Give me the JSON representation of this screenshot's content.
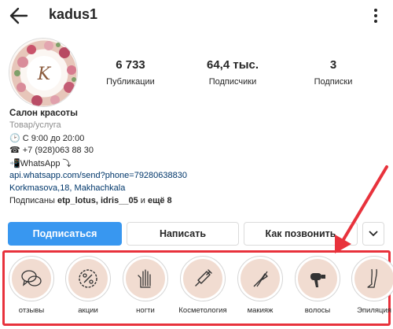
{
  "header": {
    "username": "kadus1",
    "back_icon": "arrow-left-icon",
    "more_icon": "more-vertical-icon"
  },
  "stats": [
    {
      "value": "6 733",
      "label": "Публикации"
    },
    {
      "value": "64,4 тыс.",
      "label": "Подписчики"
    },
    {
      "value": "3",
      "label": "Подписки"
    }
  ],
  "bio": {
    "name": "Салон красоты",
    "category": "Товар/услуга",
    "hours": "🕑 С 9:00 до 20:00",
    "phone": "☎ +7 (928)063 88 30",
    "whatsapp": "📲WhatsApp ⤵",
    "link": "api.whatsapp.com/send?phone=79280638830",
    "address": "Korkmasova,18, Makhachkala",
    "followed_prefix": "Подписаны ",
    "followed_names": "etp_lotus, idris__05",
    "followed_mid": " и ",
    "followed_more": "ещё 8"
  },
  "actions": {
    "follow": "Подписаться",
    "message": "Написать",
    "call": "Как позвонить"
  },
  "highlights": [
    {
      "label": "отзывы",
      "icon": "speech-bubbles-icon"
    },
    {
      "label": "акции",
      "icon": "percent-badge-icon"
    },
    {
      "label": "ногти",
      "icon": "hand-nails-icon"
    },
    {
      "label": "Косметология",
      "icon": "syringe-icon"
    },
    {
      "label": "макияж",
      "icon": "makeup-brush-icon"
    },
    {
      "label": "волосы",
      "icon": "hair-dryer-icon"
    },
    {
      "label": "Эпиляция",
      "icon": "leg-icon"
    }
  ],
  "colors": {
    "follow_button": "#3897f0",
    "annotation_red": "#e8323c",
    "highlight_bg": "#f1dcd1"
  }
}
